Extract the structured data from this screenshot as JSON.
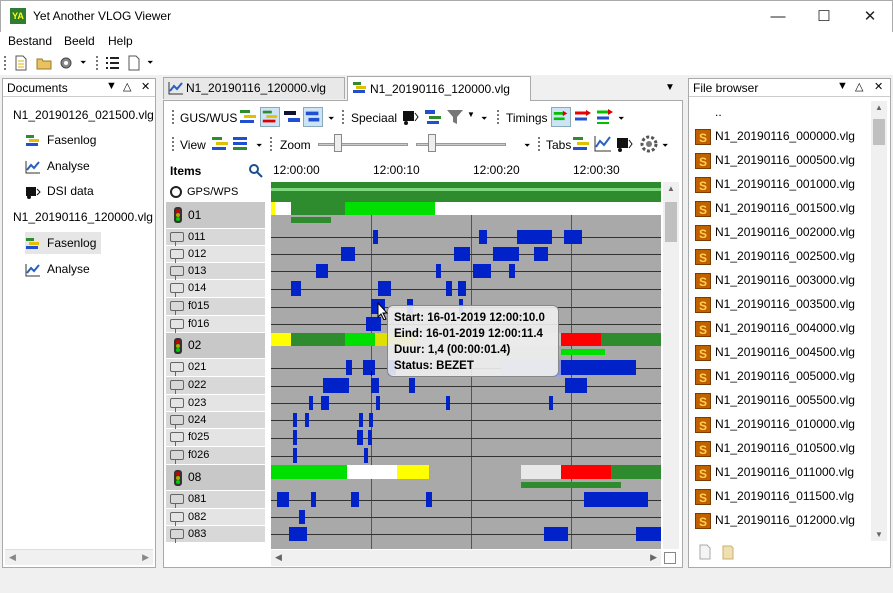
{
  "app": {
    "title": "Yet Another VLOG Viewer",
    "icon_text": "YA"
  },
  "menu": {
    "items": [
      "Bestand",
      "Beeld",
      "Help"
    ]
  },
  "documents": {
    "title": "Documents",
    "tree": [
      {
        "label": "N1_20190126_021500.vlg",
        "level": 0
      },
      {
        "label": "Fasenlog",
        "level": 1
      },
      {
        "label": "Analyse",
        "level": 1
      },
      {
        "label": "DSI data",
        "level": 1
      },
      {
        "label": "N1_20190116_120000.vlg",
        "level": 0
      },
      {
        "label": "Fasenlog",
        "level": 1
      },
      {
        "label": "Analyse",
        "level": 1
      }
    ]
  },
  "tabs": [
    {
      "label": "N1_20190116_120000.vlg"
    },
    {
      "label": "N1_20190116_120000.vlg"
    }
  ],
  "toolbar": {
    "gus": "GUS/WUS",
    "speciaal": "Speciaal",
    "timings": "Timings",
    "view": "View",
    "zoom": "Zoom",
    "tabs": "Tabs"
  },
  "timeline": {
    "items_label": "Items",
    "gps_label": "GPS/WPS",
    "times": [
      "12:00:00",
      "12:00:10",
      "12:00:20",
      "12:00:30"
    ]
  },
  "rows": [
    "01",
    "011",
    "012",
    "013",
    "014",
    "f015",
    "f016",
    "02",
    "021",
    "022",
    "023",
    "024",
    "f025",
    "f026",
    "08",
    "081",
    "082",
    "083"
  ],
  "tooltip": {
    "start": "Start: 16-01-2019 12:00:10.0",
    "eind": "Eind: 16-01-2019 12:00:11.4",
    "duur": "Duur: 1,4 (00:00:01.4)",
    "status": "Status: BEZET"
  },
  "file_browser": {
    "title": "File browser",
    "parent": "..",
    "files": [
      "N1_20190116_000000.vlg",
      "N1_20190116_000500.vlg",
      "N1_20190116_001000.vlg",
      "N1_20190116_001500.vlg",
      "N1_20190116_002000.vlg",
      "N1_20190116_002500.vlg",
      "N1_20190116_003000.vlg",
      "N1_20190116_003500.vlg",
      "N1_20190116_004000.vlg",
      "N1_20190116_004500.vlg",
      "N1_20190116_005000.vlg",
      "N1_20190116_005500.vlg",
      "N1_20190116_010000.vlg",
      "N1_20190116_010500.vlg",
      "N1_20190116_011000.vlg",
      "N1_20190116_011500.vlg",
      "N1_20190116_012000.vlg"
    ]
  },
  "colors": {
    "green": "#00e000",
    "darkgreen": "#2e8b2e",
    "yellow": "#ffff00",
    "red": "#ff0000",
    "blue": "#0022c8",
    "gray": "#a9a9a9"
  }
}
